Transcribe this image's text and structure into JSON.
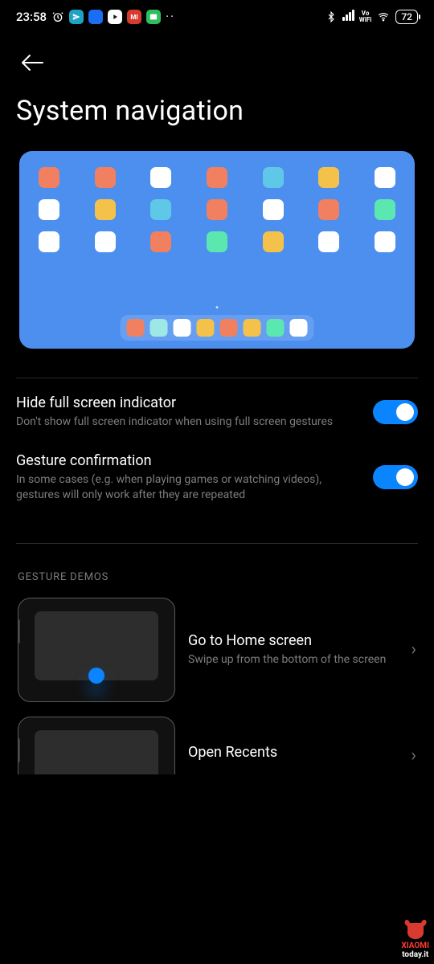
{
  "status": {
    "time": "23:58",
    "battery": "72"
  },
  "page": {
    "title": "System navigation"
  },
  "preview_grid": {
    "rows": [
      [
        "#f08060",
        "#f08060",
        "#ffffff",
        "#f08060",
        "#5ec8e6",
        "#f4c24a",
        "#ffffff"
      ],
      [
        "#ffffff",
        "#f4c24a",
        "#5ec8e6",
        "#f08060",
        "#ffffff",
        "#f08060",
        "#5ae8b0"
      ],
      [
        "#ffffff",
        "#ffffff",
        "#f08060",
        "#5ae8b0",
        "#f4c24a",
        "#ffffff",
        "#ffffff"
      ]
    ],
    "dock": [
      "#f08060",
      "#9de8e6",
      "#ffffff",
      "#f4c24a",
      "#f08060",
      "#f4c24a",
      "#5ae8b0",
      "#ffffff"
    ]
  },
  "settings": [
    {
      "key": "hide_indicator",
      "title": "Hide full screen indicator",
      "desc": "Don't show full screen indicator when using full screen gestures",
      "value": true
    },
    {
      "key": "gesture_confirmation",
      "title": "Gesture confirmation",
      "desc": "In some cases (e.g. when playing games or watching videos), gestures will only work after they are repeated",
      "value": true
    }
  ],
  "demos": {
    "section_label": "GESTURE DEMOS",
    "items": [
      {
        "title": "Go to Home screen",
        "desc": "Swipe up from the bottom of the screen"
      },
      {
        "title": "Open Recents",
        "desc": ""
      }
    ]
  },
  "watermark": {
    "brand": "XIAOMI",
    "site": "today.it"
  }
}
